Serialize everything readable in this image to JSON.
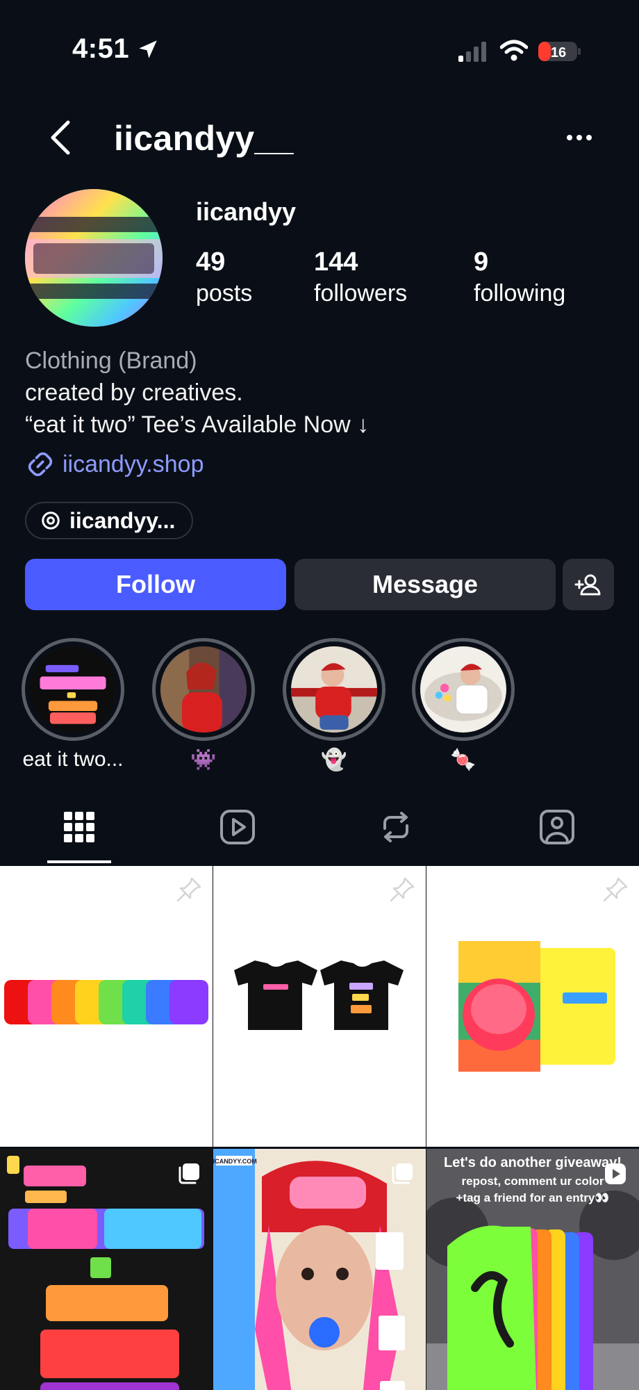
{
  "status_bar": {
    "time": "4:51",
    "battery": "16"
  },
  "header": {
    "username": "iicandyy__"
  },
  "profile": {
    "display_name": "iicandyy",
    "stats": [
      {
        "value": "49",
        "label": "posts"
      },
      {
        "value": "144",
        "label": "followers"
      },
      {
        "value": "9",
        "label": "following"
      }
    ],
    "category": "Clothing (Brand)",
    "bio_lines": [
      "created by creatives.",
      "“eat it two” Tee’s Available Now ↓"
    ],
    "link": "iicandyy.shop",
    "threads_handle": "iicandyy..."
  },
  "actions": {
    "follow": "Follow",
    "message": "Message"
  },
  "highlights": [
    {
      "label": "eat it two..."
    },
    {
      "label": "👾"
    },
    {
      "label": "👻"
    },
    {
      "label": "🍬"
    }
  ],
  "tabs": [
    "grid-tab",
    "reels-tab",
    "reposts-tab",
    "tagged-tab"
  ],
  "posts": {
    "c5_tag": "IICANDYY.COM",
    "c6_lines": [
      "Let's do another giveaway!",
      "repost, comment ur color",
      "+tag a friend for an entry👀"
    ]
  },
  "colors": {
    "background": "#0a0f17",
    "follow_button": "#4a5cff",
    "secondary_button": "#2a2d35",
    "link": "#8e9bff"
  }
}
